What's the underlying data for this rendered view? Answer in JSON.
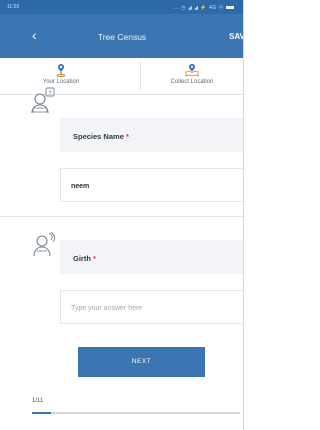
{
  "status_bar": {
    "time": "11:03",
    "icons": "... ◷ ◢ ◢ ⚡ 4G ⓝ"
  },
  "app_bar": {
    "title": "Tree Census",
    "back_label": "‹",
    "save_label": "SAVE"
  },
  "location": {
    "your_location": "Your Location",
    "collect_location": "Collect Location"
  },
  "questions": [
    {
      "label": "Species Name",
      "required_mark": "*",
      "value": "neem"
    },
    {
      "label": "Girth",
      "required_mark": "*",
      "placeholder": "Type your answer here"
    }
  ],
  "next_label": "NEXT",
  "progress": {
    "text": "1/11",
    "fraction": 0.0909
  },
  "colors": {
    "primary": "#3c76b2",
    "status_bar": "#2f6aa8",
    "required": "#e53935"
  }
}
